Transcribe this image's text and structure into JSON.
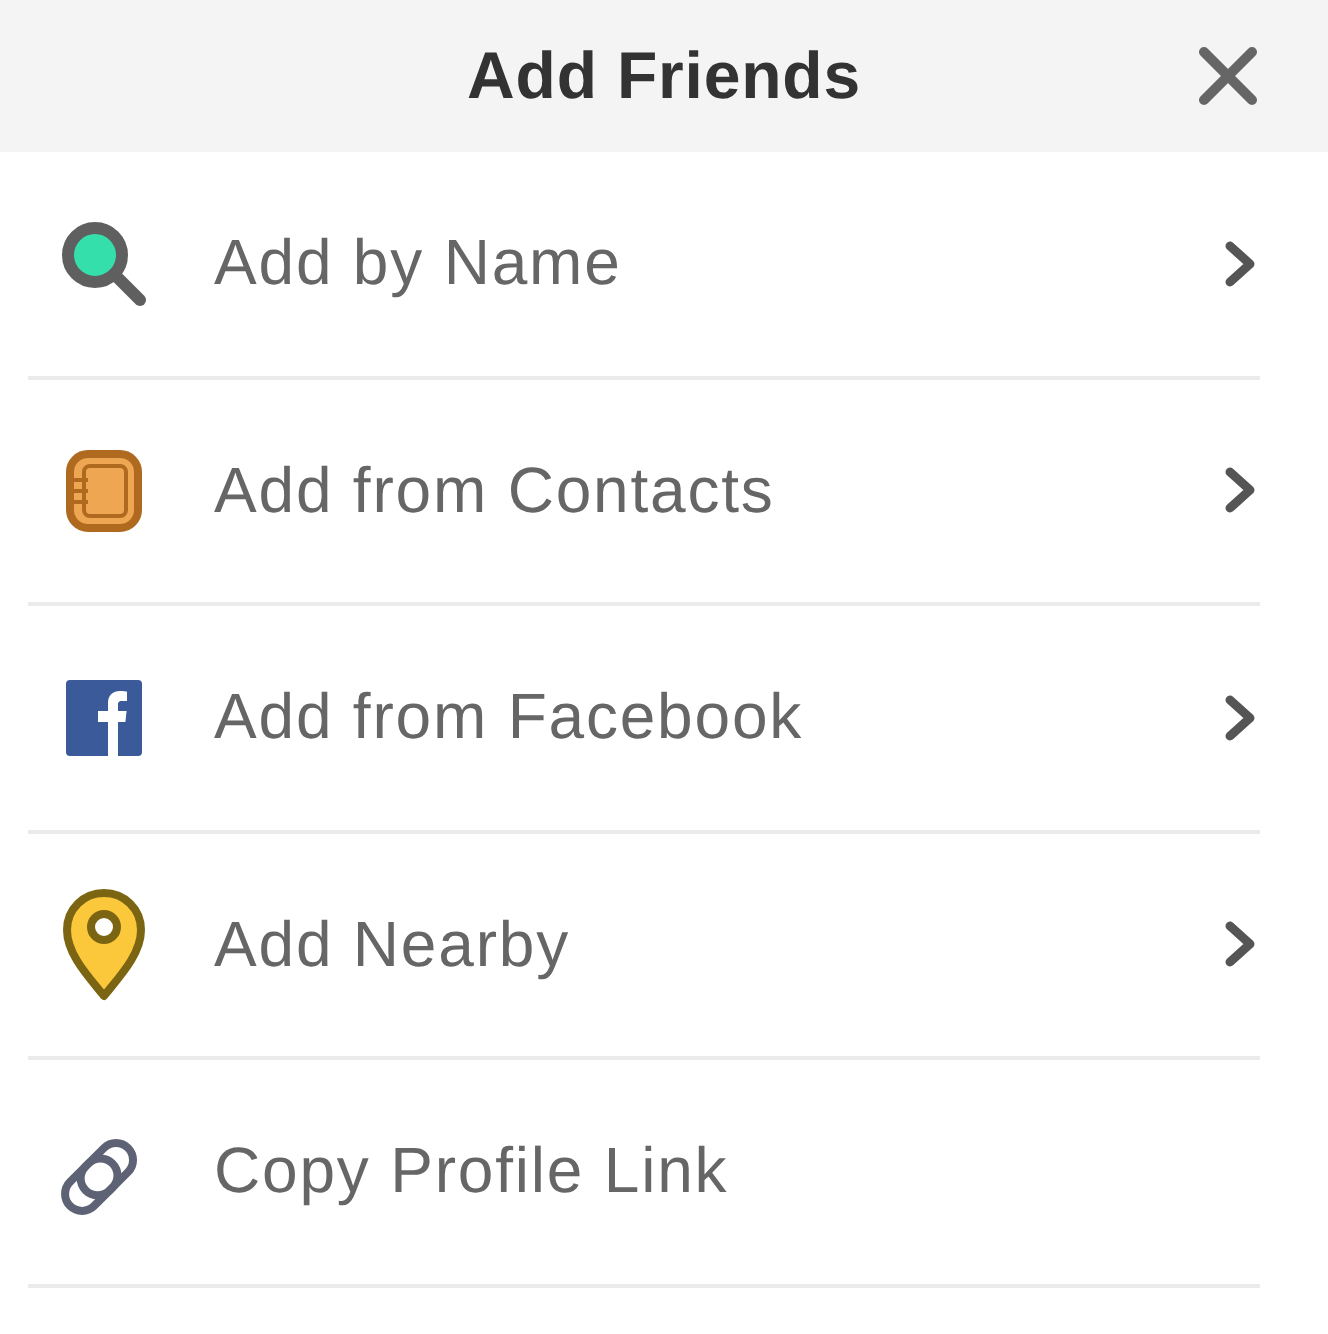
{
  "header": {
    "title": "Add Friends"
  },
  "items": [
    {
      "kind": "search",
      "label": "Add by Name",
      "disclosure": true
    },
    {
      "kind": "notebook",
      "label": "Add from Contacts",
      "disclosure": true
    },
    {
      "kind": "f-square",
      "label": "Add from Facebook",
      "disclosure": true
    },
    {
      "kind": "pin",
      "label": "Add Nearby",
      "disclosure": true
    },
    {
      "kind": "link",
      "label": "Copy Profile Link",
      "disclosure": false
    }
  ]
}
